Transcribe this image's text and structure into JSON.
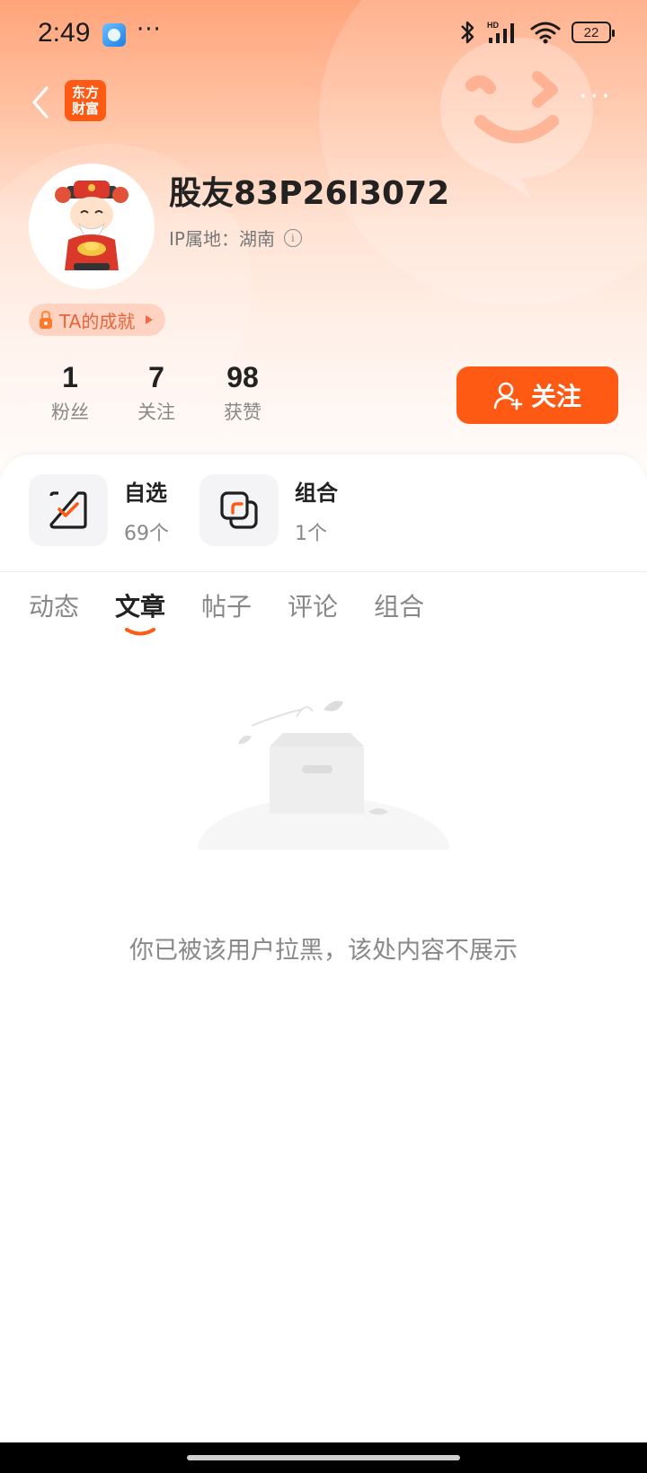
{
  "status_bar": {
    "time": "2:49",
    "more": "···",
    "battery": "22"
  },
  "nav": {
    "logo_line1": "东方",
    "logo_line2": "财富",
    "more": "···"
  },
  "profile": {
    "username": "股友83P26I3072",
    "ip_label": "IP属地：湖南",
    "achievement_label": "TA的成就"
  },
  "stats": [
    {
      "value": "1",
      "label": "粉丝"
    },
    {
      "value": "7",
      "label": "关注"
    },
    {
      "value": "98",
      "label": "获赞"
    }
  ],
  "follow_button": {
    "label": "关注"
  },
  "portfolio": [
    {
      "title": "自选",
      "count": "69个"
    },
    {
      "title": "组合",
      "count": "1个"
    }
  ],
  "tabs": [
    {
      "label": "动态",
      "active": false
    },
    {
      "label": "文章",
      "active": true
    },
    {
      "label": "帖子",
      "active": false
    },
    {
      "label": "评论",
      "active": false
    },
    {
      "label": "组合",
      "active": false
    }
  ],
  "empty_state": {
    "message": "你已被该用户拉黑，该处内容不展示"
  },
  "colors": {
    "accent": "#ff5a14",
    "hero_top": "#ffa47a"
  }
}
